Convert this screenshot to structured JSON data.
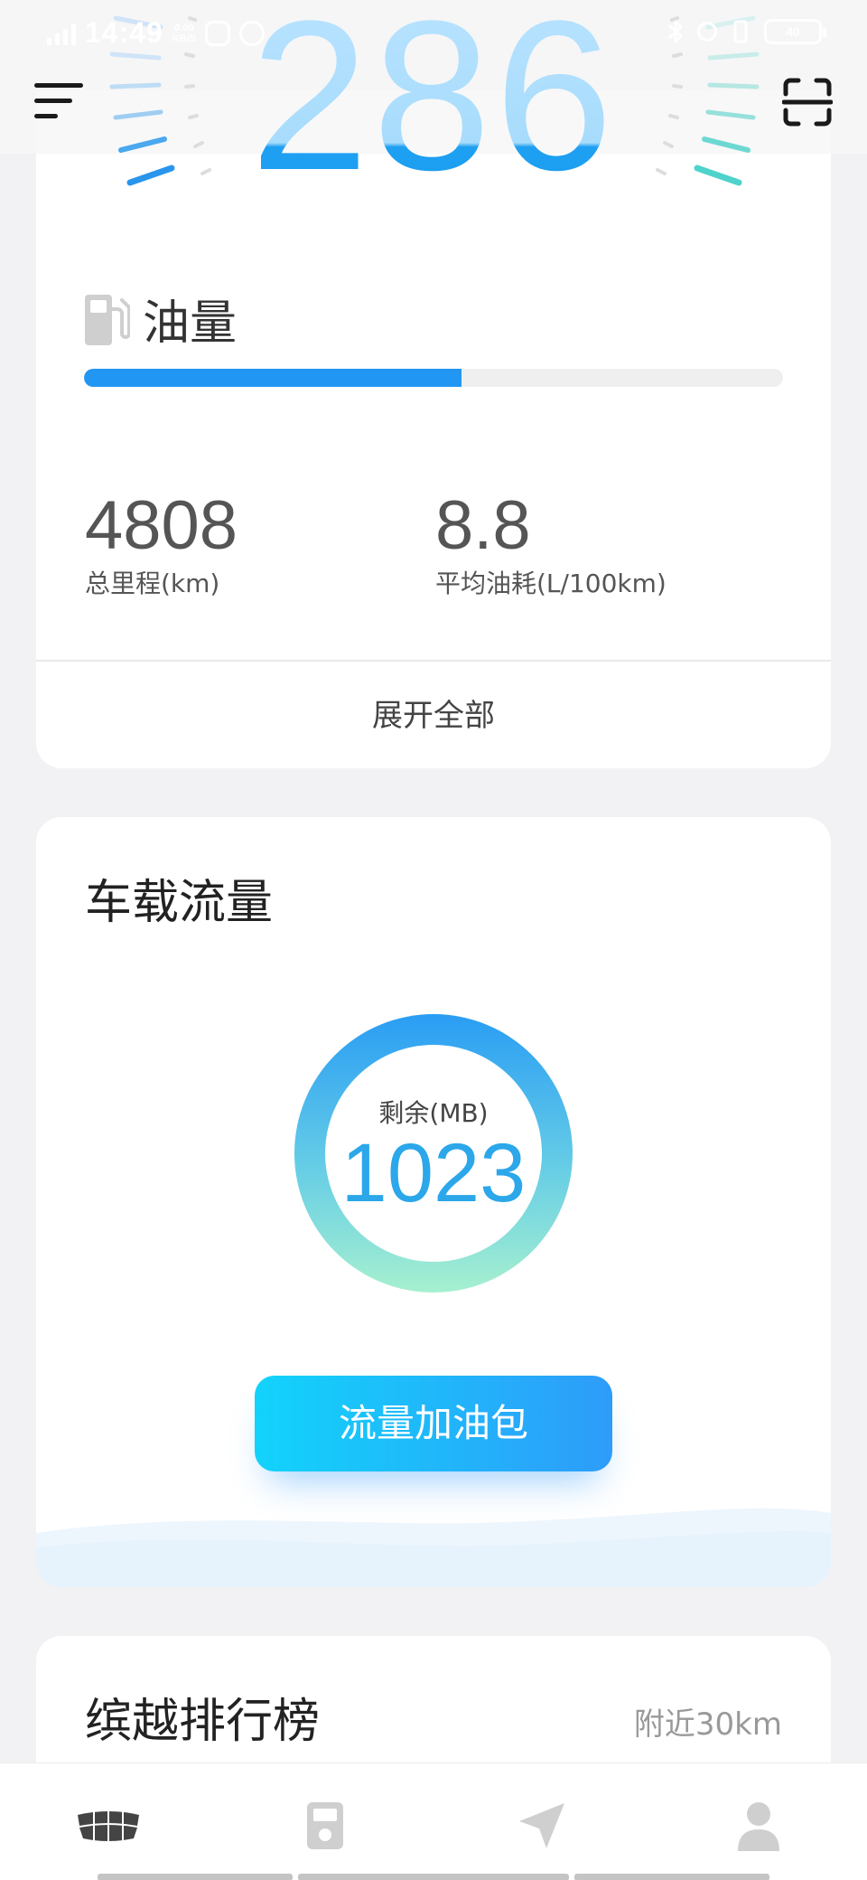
{
  "status_bar": {
    "time": "14:49",
    "net_speed_value": "0.00",
    "net_speed_unit": "KB/S",
    "battery": "40"
  },
  "gauge": {
    "speed": "286"
  },
  "fuel": {
    "title": "油量",
    "level_percent": 54,
    "total_mileage_value": "4808",
    "total_mileage_label": "总里程(km)",
    "avg_consumption_value": "8.8",
    "avg_consumption_label": "平均油耗(L/100km)",
    "expand_label": "展开全部"
  },
  "data_plan": {
    "title": "车载流量",
    "remaining_label": "剩余(MB)",
    "remaining_value": "1023",
    "topup_button": "流量加油包"
  },
  "ranking": {
    "title": "缤越排行榜",
    "distance": "附近30km"
  },
  "bottom_nav": {
    "items": [
      {
        "icon": "car-logo-icon"
      },
      {
        "icon": "car-key-icon"
      },
      {
        "icon": "navigation-arrow-icon"
      },
      {
        "icon": "person-icon"
      }
    ]
  },
  "colors": {
    "accent": "#2196f3",
    "gauge_blue": "#1a9cf0",
    "button_start": "#12d3fb",
    "button_end": "#2e9cf9"
  }
}
